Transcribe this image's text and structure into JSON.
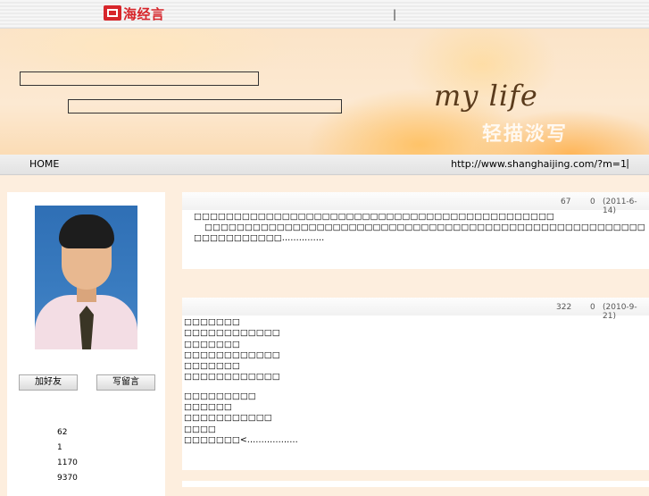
{
  "topbar": {
    "logo_text": "海经言",
    "separator": "|"
  },
  "banner": {
    "tagline": "my life",
    "deco_text": "轻描淡写"
  },
  "nav": {
    "home": "HOME",
    "url": "http://www.shanghaijing.com/?m=1",
    "separator": "|"
  },
  "sidebar": {
    "add_friend": "加好友",
    "write_message": "写留言",
    "stats": [
      "62",
      "1",
      "1170",
      "9370"
    ]
  },
  "posts": [
    {
      "views": "67",
      "comments": "0",
      "date": "(2011-6-14)",
      "lines": [
        "□□□□□□□□□□□□□□□□□□□□□□□□□□□□□□□□□□□□□□□□□□□□□",
        "□□□□□□□□□□□□□□□□□□□□□□□□□□□□□□□□□□□□□□□□□□□□□□□□□□□□□□□□□□□□□□□□□□□□□□□□",
        "□□□□□□□□□□□……………"
      ]
    },
    {
      "views": "322",
      "comments": "0",
      "date": "(2010-9-21)",
      "lines": [
        "□□□□□□□",
        "□□□□□□□□□□□□",
        "□□□□□□□",
        "□□□□□□□□□□□□",
        "□□□□□□□",
        "□□□□□□□□□□□□",
        "",
        "□□□□□□□□□",
        "□□□□□□",
        "□□□□□□□□□□□",
        "□□□□",
        "□□□□□□□<………………"
      ]
    }
  ]
}
